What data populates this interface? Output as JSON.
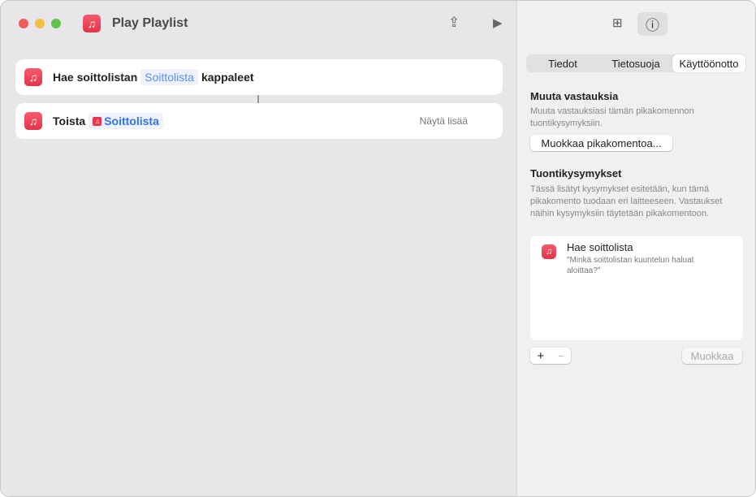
{
  "window": {
    "title": "Play Playlist"
  },
  "actions": [
    {
      "prefix": "Hae soittolistan",
      "token": "Soittolista",
      "suffix": "kappaleet"
    },
    {
      "prefix": "Toista",
      "token": "Soittolista",
      "more": "Näytä lisää"
    }
  ],
  "sidebar": {
    "tabs": [
      "Tiedot",
      "Tietosuoja",
      "Käyttöönotto"
    ],
    "selected_tab": "Käyttöönotto",
    "section1": {
      "title": "Muuta vastauksia",
      "desc": "Muuta vastauksiasi tämän pikakomennon tuontikysymyksiin.",
      "button": "Muokkaa pikakomentoa..."
    },
    "section2": {
      "title": "Tuontikysymykset",
      "desc": "Tässä lisätyt kysymykset esitetään, kun tämä pikakomento tuodaan eri laitteeseen. Vastaukset näihin kysymyksiin täytetään pikakomentoon."
    },
    "questions": [
      {
        "title": "Hae soittolista",
        "question": "\"Minkä soittolistan kuuntelun haluat aloittaa?\""
      }
    ],
    "add": "+",
    "remove": "−",
    "edit": "Muokkaa"
  },
  "colors": {
    "accent": "#2f73ee",
    "app": "#e8374d"
  }
}
